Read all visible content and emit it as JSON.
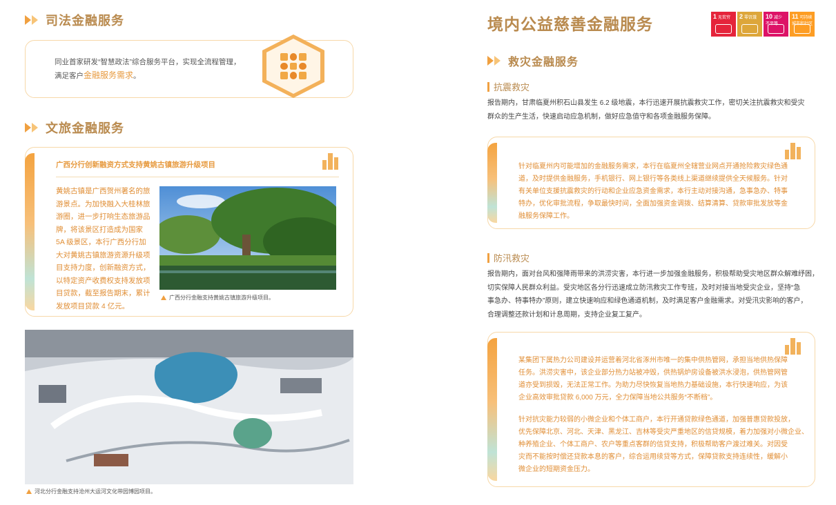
{
  "left": {
    "judicial": {
      "title": "司法金融服务",
      "text_line1": "同业首家研发“智慧政法”综合服务平台，实现全流程管理，",
      "text_line2_pre": "满足客户",
      "text_highlight": "金融服务需求",
      "text_line2_post": "。"
    },
    "tourism": {
      "title": "文旅金融服务",
      "card_title": "广西分行创新融资方式支持黄姚古镇旅游升级项目",
      "body_lines": [
        "黄姚古镇是广西贺州著名的旅",
        "游景点。为加快融入大桂林旅",
        "游圈，进一步打响生态旅游品",
        "牌，将该景区打造成为国家",
        "5A 级景区，本行广西分行加",
        "大对黄姚古镇旅游资源升级项",
        "目支持力度，创新融资方式，",
        "以特定资产收费权支持发放项",
        "目贷款，截至报告期末，累计",
        "发放项目贷款 4 亿元。"
      ],
      "photo_caption": "广西分行金融支持黄姚古镇旅游升级项目。",
      "aerial_caption": "河北分行金融支持沧州大运河文化带园博园项目。"
    }
  },
  "right": {
    "main_title": "境内公益慈善金融服务",
    "sdg": [
      {
        "num": "1",
        "label": "无贫穷",
        "color": "#e5243b"
      },
      {
        "num": "2",
        "label": "零饥饿",
        "color": "#dda63a"
      },
      {
        "num": "10",
        "label": "减少不平等",
        "color": "#dd1367"
      },
      {
        "num": "11",
        "label": "可持续城市和社区",
        "color": "#fd9d24"
      }
    ],
    "disaster_title": "救灾金融服务",
    "earthquake": {
      "subtitle": "抗震救灾",
      "intro_lines": [
        "报告期内，甘肃临夏州积石山县发生 6.2 级地震，本行迅速开展抗震救灾工作，密切关注抗震救灾和受灾",
        "群众的生产生活，快速启动应急机制，做好应急值守和各项金融服务保障。"
      ],
      "card_lines": [
        "针对临夏州内可能增加的金融服务需求，本行在临夏州全辖营业网点开通抢险救灾绿色通",
        "道，及时提供金融服务，手机银行、网上银行等各类线上渠道继续提供全天候服务。针对",
        "有关单位支援抗震救灾的行动和企业应急资金需求，本行主动对接沟通，急事急办、特事",
        "特办，优化审批流程，争取最快时间，全面加强资金调拨、结算清算、贷款审批发放等金",
        "融服务保障工作。"
      ]
    },
    "flood": {
      "subtitle": "防汛救灾",
      "intro_lines": [
        "报告期内，面对台风和强降雨带来的洪涝灾害，本行进一步加强金融服务，积极帮助受灾地区群众解难纾困，",
        "切实保障人民群众利益。受灾地区各分行迅速成立防汛救灾工作专班，及时对接当地受灾企业，坚持“急",
        "事急办、特事特办”原则，建立快速响应和绿色通道机制，及时满足客户金融需求。对受汛灾影响的客户，",
        "合理调整还款计划和计息周期，支持企业复工复产。"
      ],
      "card_p1": [
        "某集团下属热力公司建设并运营着河北省涿州市唯一的集中供热管网，承担当地供热保障",
        "任务。洪涝灾害中，该企业部分热力站被冲毁，供热锅炉房设备被洪水浸泡，供热管网管",
        "道亦受到损毁，无法正常工作。为助力尽快恢复当地热力基础设施，本行快速响应，为该",
        "企业高效审批贷款 6,000 万元，全力保障当地公共服务“不断档”。"
      ],
      "card_p2": [
        "针对抗灾能力较弱的小微企业和个体工商户，本行开通贷款绿色通道，加强普惠贷款投放，",
        "优先保障北京、河北、天津、黑龙江、吉林等受灾严重地区的信贷规模，着力加强对小微企业、",
        "种养殖企业、个体工商户、农户等重点客群的信贷支持，积极帮助客户渡过难关。对因受",
        "灾而不能按时偿还贷款本息的客户，综合运用续贷等方式，保障贷款支持连续性，缓解小",
        "微企业的短期资金压力。"
      ]
    }
  }
}
